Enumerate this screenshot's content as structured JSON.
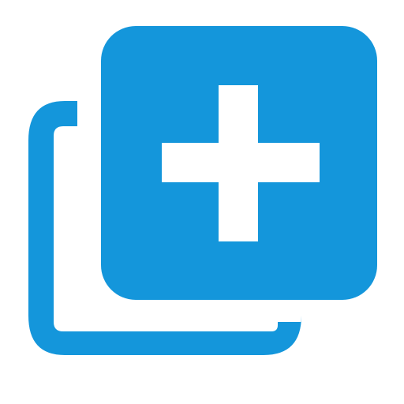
{
  "icon": {
    "name": "add-to-collection-icon",
    "description_glyphs": [
      "back-square-outline",
      "front-square",
      "plus-sign"
    ],
    "colors": {
      "accent": "#1496DB",
      "background": "#FFFFFF",
      "plus": "#FFFFFF"
    }
  }
}
